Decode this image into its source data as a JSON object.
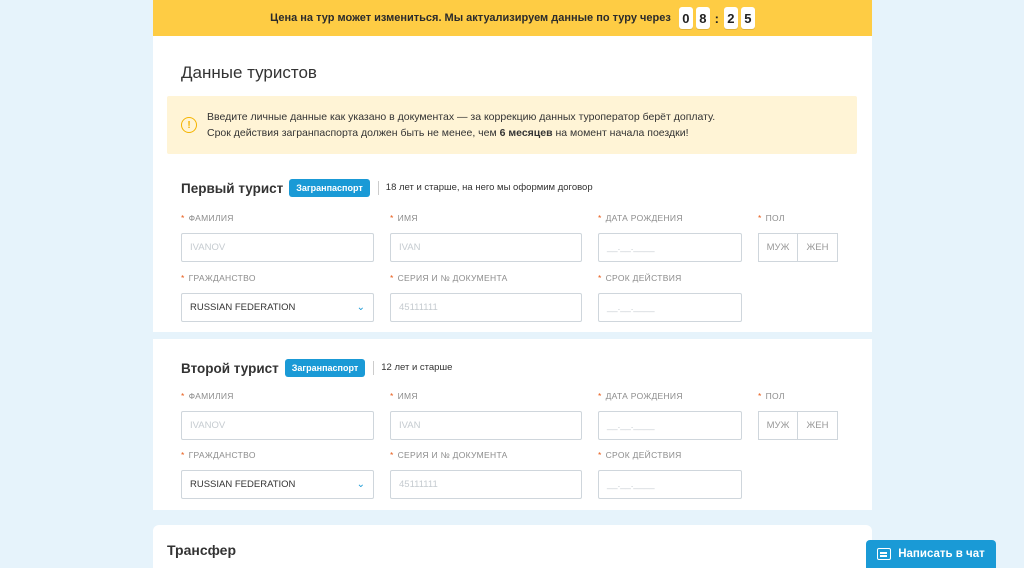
{
  "banner": {
    "text": "Цена на тур может измениться. Мы актуализируем данные по туру через",
    "timer": [
      "0",
      "8",
      "2",
      "5"
    ]
  },
  "section_title": "Данные туристов",
  "notice": {
    "line1": "Введите личные данные как указано в документах — за коррекцию данных туроператор берёт доплату.",
    "line2_start": "Срок действия загранпаспорта должен быть не менее, чем ",
    "line2_bold": "6 месяцев",
    "line2_end": " на момент начала поездки!"
  },
  "labels": {
    "surname": "ФАМИЛИЯ",
    "name": "ИМЯ",
    "birthdate": "ДАТА РОЖДЕНИЯ",
    "gender": "ПОЛ",
    "citizenship": "ГРАЖДАНСТВО",
    "document": "СЕРИЯ И № ДОКУМЕНТА",
    "expiry": "СРОК ДЕЙСТВИЯ"
  },
  "placeholders": {
    "surname": "IVANOV",
    "name": "IVAN",
    "document": "45111111",
    "date": "__.__.____"
  },
  "gender_options": {
    "male": "МУЖ",
    "female": "ЖЕН"
  },
  "tourists": [
    {
      "title": "Первый турист",
      "badge": "Загранпаспорт",
      "note": "18 лет и старше, на него мы оформим договор",
      "citizenship": "RUSSIAN FEDERATION"
    },
    {
      "title": "Второй турист",
      "badge": "Загранпаспорт",
      "note": "12 лет и старше",
      "citizenship": "RUSSIAN FEDERATION"
    }
  ],
  "transfer_title": "Трансфер",
  "chat_button": "Написать в чат"
}
